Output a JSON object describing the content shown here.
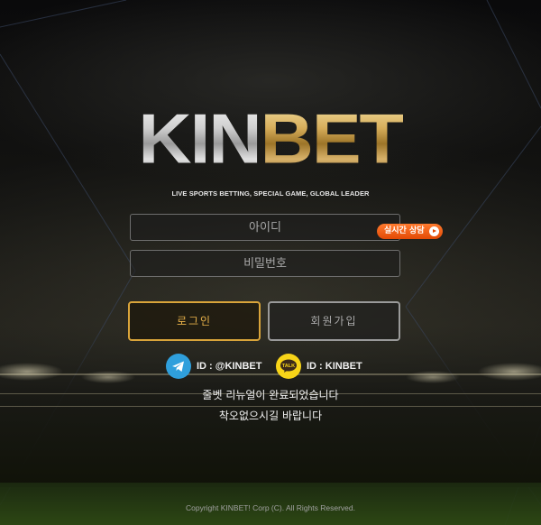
{
  "brand": {
    "logo_left": "KIN",
    "logo_right": "BET",
    "tagline": "LIVE SPORTS BETTING, SPECIAL GAME, GLOBAL LEADER"
  },
  "login_form": {
    "id_placeholder": "아이디",
    "password_placeholder": "비밀번호",
    "live_chat_label": "실시간 상담",
    "login_button": "로그인",
    "signup_button": "회원가입"
  },
  "contacts": {
    "telegram": {
      "icon": "telegram-icon",
      "text": "ID : @KINBET",
      "color": "#2f9fdc"
    },
    "kakaotalk": {
      "icon": "kakaotalk-icon",
      "badge": "TALK",
      "text": "ID : KINBET",
      "color": "#f7d418"
    }
  },
  "notice": {
    "line1": "줄벳 리뉴얼이 완료되었습니다",
    "line2": "착오없으시길 바랍니다"
  },
  "footer": {
    "copyright": "Copyright KINBET! Corp (C). All Rights Reserved."
  },
  "colors": {
    "accent_gold": "#d9a43a",
    "accent_orange": "#e24a05",
    "background": "#0b0b0c"
  }
}
